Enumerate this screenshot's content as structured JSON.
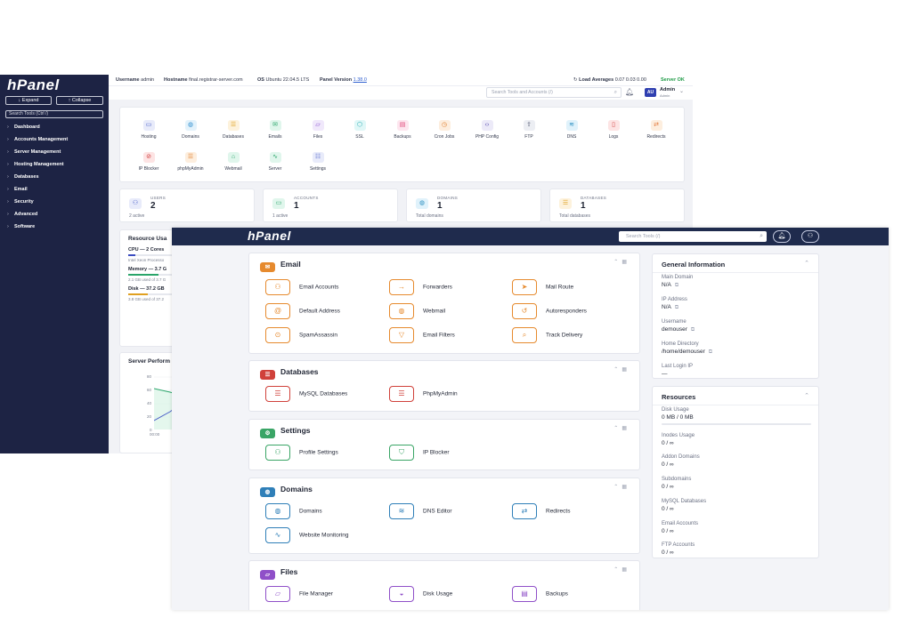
{
  "admin": {
    "logo": "hPanel",
    "expand_label": "↓ Expand",
    "collapse_label": "↑ Collapse",
    "search_placeholder": "Search Tools (Ctrl /)",
    "nav": [
      "Dashboard",
      "Accounts Management",
      "Server Management",
      "Hosting Management",
      "Databases",
      "Email",
      "Security",
      "Advanced",
      "Software"
    ],
    "topbar": {
      "username_label": "Username",
      "username": "admin",
      "hostname_label": "Hostname",
      "hostname": "final.registrar-server.com",
      "os_label": "OS",
      "os": "Ubuntu 22.04.5 LTS",
      "version_label": "Panel Version",
      "version": "1.38.0",
      "load_label": "Load Averages",
      "load": "0.07 0.03 0.00",
      "status": "Server OK"
    },
    "tools_search_placeholder": "Search Tools and Accounts (/)",
    "user_initials": "AU",
    "user_name": "Admin",
    "user_role": "Admin",
    "tools": [
      "Hosting",
      "Domains",
      "Databases",
      "Emails",
      "Files",
      "SSL",
      "Backups",
      "Cron Jobs",
      "PHP Config",
      "FTP",
      "DNS",
      "Logs",
      "Redirects",
      "IP Blocker",
      "phpMyAdmin",
      "Webmail",
      "Server",
      "Settings"
    ],
    "stats": [
      {
        "label": "USERS",
        "value": "2",
        "sub": "2 active"
      },
      {
        "label": "ACCOUNTS",
        "value": "1",
        "sub": "1 active"
      },
      {
        "label": "DOMAINS",
        "value": "1",
        "sub": "Total domains"
      },
      {
        "label": "DATABASES",
        "value": "1",
        "sub": "Total databases"
      }
    ],
    "resource_title": "Resource Usa",
    "cpu_label": "CPU — 2 Cores",
    "cpu_sub": "Intel Xeon Processo",
    "memory_label": "Memory — 3.7 G",
    "memory_sub": "2.1 GB used of 3.7 G",
    "disk_label": "Disk — 37.2 GB",
    "disk_sub": "3.8 GB used of 37.2",
    "perf_title": "Server Perform",
    "perf_ticks": [
      "80",
      "60",
      "40",
      "20",
      "0"
    ],
    "perf_time": "00:00"
  },
  "cp": {
    "logo": "hPanel",
    "search_placeholder": "Search Tools (/)",
    "sections": [
      {
        "title": "Email",
        "items": [
          "Email Accounts",
          "Forwarders",
          "Mail Route",
          "Default Address",
          "Webmail",
          "Autoresponders",
          "SpamAssassin",
          "Email Filters",
          "Track Delivery"
        ]
      },
      {
        "title": "Databases",
        "items": [
          "MySQL Databases",
          "PhpMyAdmin"
        ]
      },
      {
        "title": "Settings",
        "items": [
          "Profile Settings",
          "IP Blocker"
        ]
      },
      {
        "title": "Domains",
        "items": [
          "Domains",
          "DNS Editor",
          "Redirects",
          "Website Monitoring"
        ]
      },
      {
        "title": "Files",
        "items": [
          "File Manager",
          "Disk Usage",
          "Backups"
        ]
      }
    ],
    "general": {
      "title": "General Information",
      "fields": [
        {
          "label": "Main Domain",
          "value": "N/A"
        },
        {
          "label": "IP Address",
          "value": "N/A"
        },
        {
          "label": "Username",
          "value": "demouser"
        },
        {
          "label": "Home Directory",
          "value": "/home/demouser"
        },
        {
          "label": "Last Login IP",
          "value": "—"
        }
      ]
    },
    "resources": {
      "title": "Resources",
      "fields": [
        {
          "label": "Disk Usage",
          "value": "0 MB / 0 MB"
        },
        {
          "label": "Inodes Usage",
          "value": "0 / ∞"
        },
        {
          "label": "Addon Domains",
          "value": "0 / ∞"
        },
        {
          "label": "Subdomains",
          "value": "0 / ∞"
        },
        {
          "label": "MySQL Databases",
          "value": "0 / ∞"
        },
        {
          "label": "Email Accounts",
          "value": "0 / ∞"
        },
        {
          "label": "FTP Accounts",
          "value": "0 / ∞"
        }
      ]
    }
  },
  "colors": {
    "email": "#e68a2e",
    "databases": "#d0413a",
    "settings": "#3aa566",
    "domains": "#2f7fb8",
    "files": "#8f4fc8",
    "navy": "#1f2b4d"
  }
}
